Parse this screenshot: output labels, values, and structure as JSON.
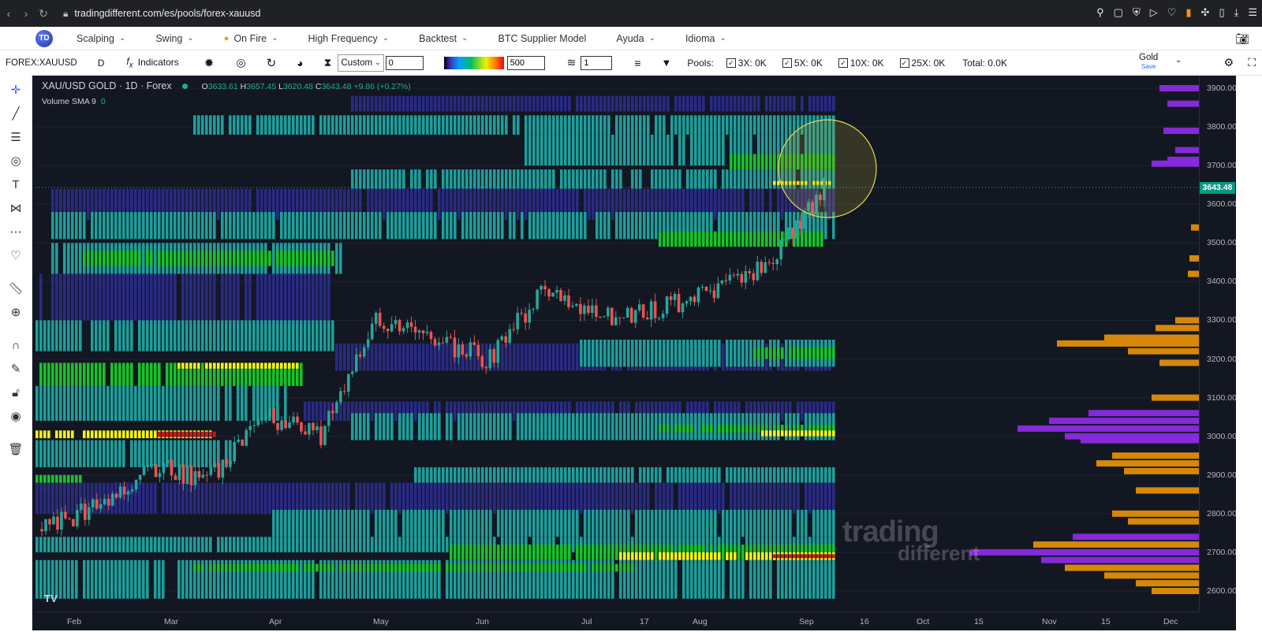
{
  "browser": {
    "url": "tradingdifferent.com/es/pools/forex-xauusd",
    "nav_icons": [
      "back-icon",
      "forward-icon",
      "reload-icon",
      "lock-icon"
    ],
    "extension_icons": [
      "pin-icon",
      "screenshot-icon",
      "shield-icon",
      "play-icon",
      "heart-icon",
      "flag-icon",
      "puzzle-icon",
      "sidebar-icon",
      "download-icon",
      "menu-icon"
    ]
  },
  "menu": {
    "items": [
      {
        "label": "Scalping"
      },
      {
        "label": "Swing"
      },
      {
        "label": "On Fire"
      },
      {
        "label": "High Frequency"
      },
      {
        "label": "Backtest"
      },
      {
        "label": "BTC Supplier Model"
      },
      {
        "label": "Ayuda"
      },
      {
        "label": "Idioma"
      }
    ]
  },
  "toolbar": {
    "symbol": "FOREX:XAUUSD",
    "interval": "D",
    "indicators_label": "Indicators",
    "range_select": "Custom",
    "range_value": "0",
    "gradient_value": "500",
    "layer_value": "1",
    "pools_label": "Pools:",
    "pool_3x": "3X: 0K",
    "pool_5x": "5X: 0K",
    "pool_10x": "10X: 0K",
    "pool_25x": "25X: 0K",
    "total": "Total: 0.0K",
    "asset_label": "Gold",
    "asset_sub": "Save"
  },
  "legend": {
    "title": "XAU/USD GOLD · 1D · Forex",
    "open_k": "O",
    "open": "3633.61",
    "high_k": "H",
    "high": "3657.45",
    "low_k": "L",
    "low": "3620.48",
    "close_k": "C",
    "close": "3643.48",
    "change": "+9.86 (+0.27%)",
    "volume_label": "Volume SMA 9",
    "volume_value": "0"
  },
  "price_axis": {
    "ticks": [
      "3900.00",
      "3800.00",
      "3700.00",
      "3600.00",
      "3500.00",
      "3400.00",
      "3300.00",
      "3200.00",
      "3100.00",
      "3000.00",
      "2900.00",
      "2800.00",
      "2700.00",
      "2600.00"
    ],
    "current": "3643.48"
  },
  "time_axis": {
    "ticks": [
      "Feb",
      "Mar",
      "Apr",
      "May",
      "Jun",
      "Jul",
      "17",
      "Aug",
      "Sep",
      "16",
      "Oct",
      "15",
      "Nov",
      "15",
      "Dec"
    ]
  },
  "watermark": {
    "line1": "trading",
    "line2": "different"
  },
  "colors": {
    "background": "#131722",
    "heat_low": "#2a2a86",
    "heat_mid": "#1e9e9a",
    "heat_high": "#19c22a",
    "heat_peak": "#f5f50a",
    "heat_max": "#d01818",
    "candle_up": "#26a69a",
    "candle_down": "#ef5350",
    "profile_orange": "#e08e0b",
    "profile_purple": "#8a2be2"
  },
  "chart_data": {
    "type": "heatmap",
    "title": "XAU/USD GOLD · 1D · Forex",
    "ylim": [
      2570,
      3940
    ],
    "price_levels": [
      2600,
      2700,
      2800,
      2900,
      3000,
      3100,
      3200,
      3300,
      3400,
      3500,
      3600,
      3700,
      3800,
      3900
    ],
    "candles_close_path": [
      {
        "month": "Feb",
        "close": 2760
      },
      {
        "month": "Feb",
        "close": 2820
      },
      {
        "month": "Mar",
        "close": 2920
      },
      {
        "month": "Mar",
        "close": 2890
      },
      {
        "month": "Apr",
        "close": 3050
      },
      {
        "month": "Apr",
        "close": 3000
      },
      {
        "month": "Apr",
        "close": 3300
      },
      {
        "month": "May",
        "close": 3250
      },
      {
        "month": "May",
        "close": 3200
      },
      {
        "month": "Jun",
        "close": 3380
      },
      {
        "month": "Jun",
        "close": 3310
      },
      {
        "month": "Jul",
        "close": 3330
      },
      {
        "month": "Aug",
        "close": 3370
      },
      {
        "month": "Sep",
        "close": 3450
      },
      {
        "month": "Sep",
        "close": 3643.48
      }
    ],
    "current_close": 3643.48
  }
}
